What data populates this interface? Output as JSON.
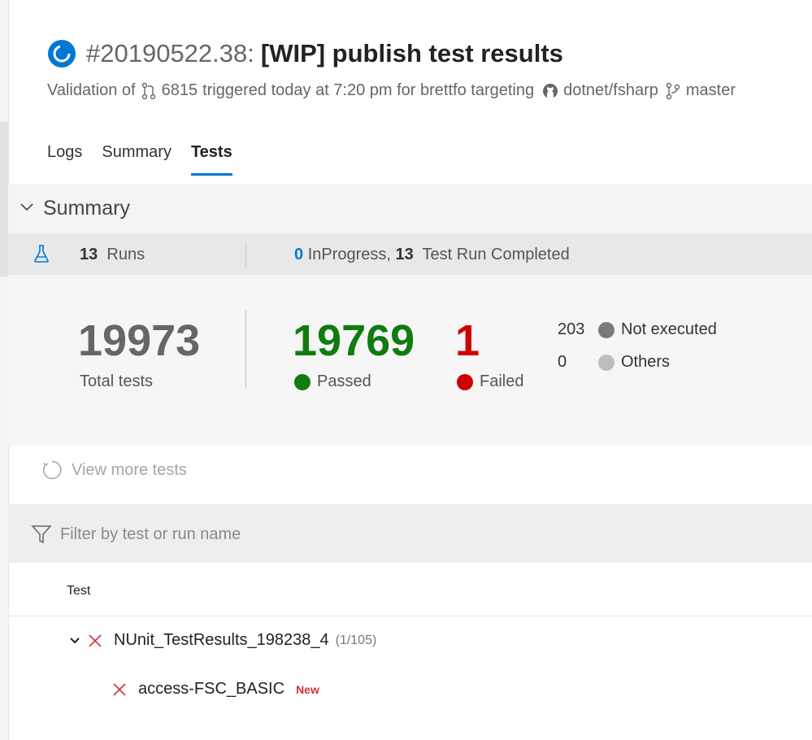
{
  "header": {
    "build_number": "#20190522.38:",
    "title": "[WIP] publish test results",
    "subtitle": {
      "prefix": "Validation of",
      "pr_number": "6815",
      "middle": "triggered today at 7:20 pm for brettfo targeting",
      "repo": "dotnet/fsharp",
      "branch": "master"
    }
  },
  "tabs": [
    "Logs",
    "Summary",
    "Tests"
  ],
  "active_tab": "Tests",
  "summary": {
    "heading": "Summary",
    "runs_count": "13",
    "runs_label": "Runs",
    "in_progress_count": "0",
    "in_progress_label": "InProgress,",
    "completed_count": "13",
    "completed_label": "Test Run Completed",
    "total": {
      "value": "19973",
      "label": "Total tests"
    },
    "passed": {
      "value": "19769",
      "label": "Passed"
    },
    "failed": {
      "value": "1",
      "label": "Failed"
    },
    "not_executed": {
      "value": "203",
      "label": "Not executed"
    },
    "others": {
      "value": "0",
      "label": "Others"
    }
  },
  "view_more": "View more tests",
  "filter": {
    "placeholder": "Filter by test or run name"
  },
  "table": {
    "column_test": "Test",
    "rows": [
      {
        "name": "NUnit_TestResults_198238_4",
        "count": "(1/105)"
      },
      {
        "name": "access-FSC_BASIC",
        "badge": "New"
      }
    ]
  },
  "colors": {
    "accent": "#0078d4",
    "passed": "#107c10",
    "failed": "#d10000",
    "not_executed": "#7a7a7a",
    "others": "#bdbdbd"
  }
}
